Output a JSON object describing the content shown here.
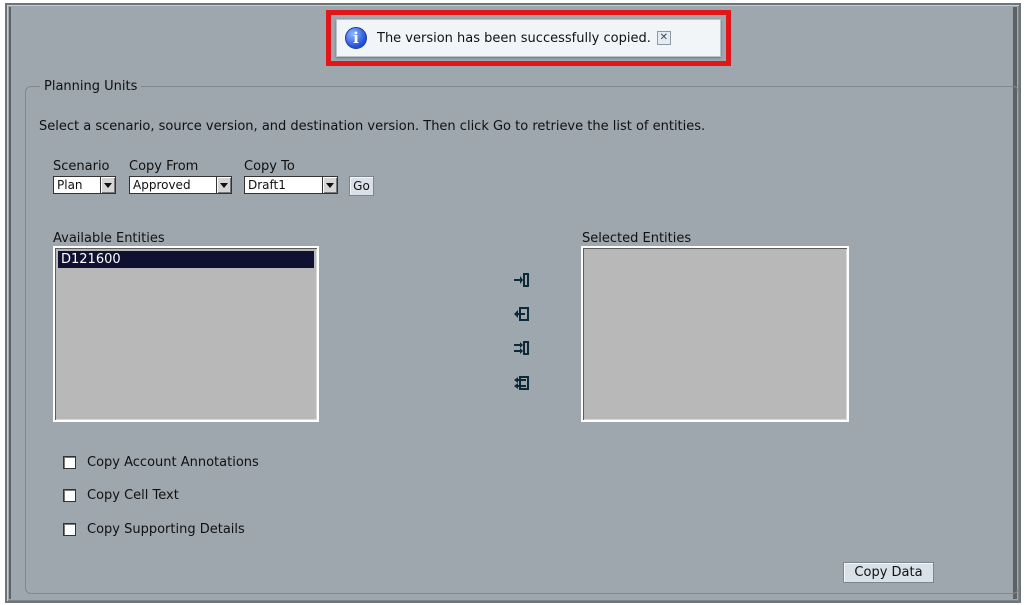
{
  "notification": {
    "message": "The version has been successfully copied.",
    "close_glyph": "✕",
    "icon_glyph": "i"
  },
  "panel": {
    "title": "Planning Units",
    "instructions": "Select a scenario, source version, and destination version. Then click Go to retrieve the list of entities."
  },
  "filters": {
    "scenario": {
      "label": "Scenario",
      "value": "Plan"
    },
    "copy_from": {
      "label": "Copy From",
      "value": "Approved"
    },
    "copy_to": {
      "label": "Copy To",
      "value": "Draft1"
    },
    "go_label": "Go"
  },
  "available": {
    "label": "Available Entities",
    "items": [
      "D121600"
    ]
  },
  "selected": {
    "label": "Selected Entities",
    "items": []
  },
  "options": [
    {
      "label": "Copy Account Annotations",
      "checked": false
    },
    {
      "label": "Copy Cell Text",
      "checked": false
    },
    {
      "label": "Copy Supporting Details",
      "checked": false
    }
  ],
  "copy_data_label": "Copy Data",
  "colors": {
    "panel_bg": "#9ea6ae",
    "highlight": "#e0161a",
    "list_selected": "#101031"
  }
}
